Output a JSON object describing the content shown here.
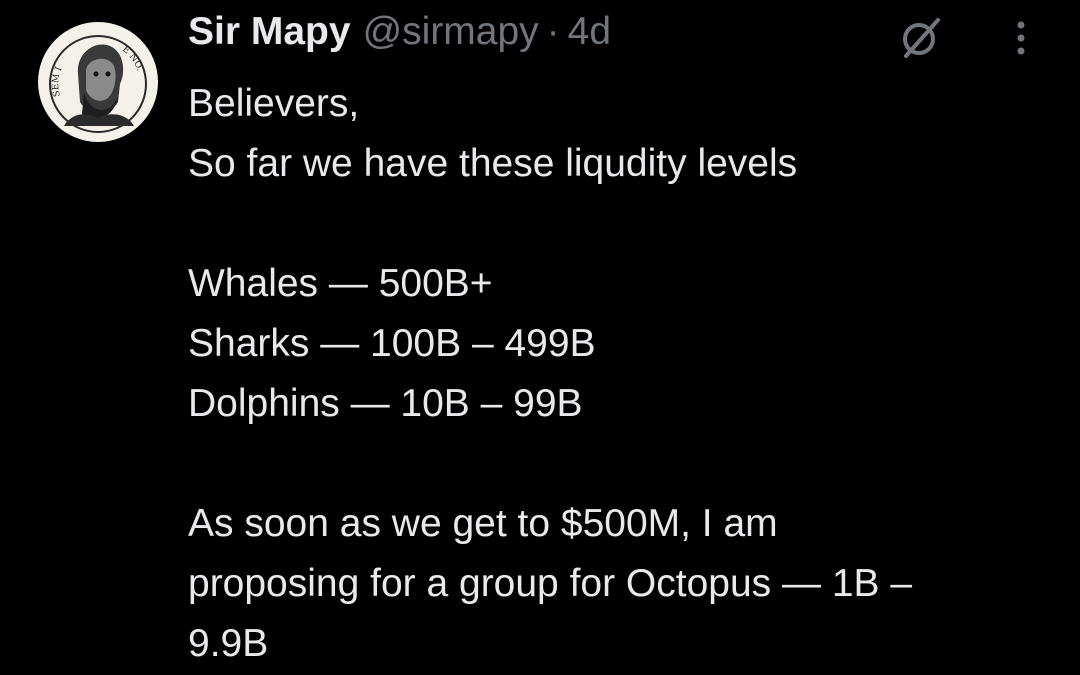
{
  "author": {
    "display_name": "Sir Mapy",
    "handle": "@sirmapy",
    "separator": "·",
    "time_ago": "4d",
    "avatar_icon": "engraved-portrait-medallion",
    "avatar_inscription_left": "SEM I",
    "avatar_inscription_right": "E NO."
  },
  "actions": {
    "grok_icon": "grok-slash-icon",
    "more_icon": "vertical-ellipsis-icon"
  },
  "tweet": {
    "lines": [
      "Believers,",
      "So far we have these liqudity levels",
      "",
      "Whales — 500B+",
      "Sharks — 100B – 499B",
      "Dolphins — 10B – 99B",
      "",
      "As soon as we get to $500M, I am",
      "proposing for a group for Octopus — 1B –",
      "9.9B"
    ]
  },
  "colors": {
    "background": "#000000",
    "primary_text": "#e7e9ea",
    "secondary_text": "#71767b"
  }
}
